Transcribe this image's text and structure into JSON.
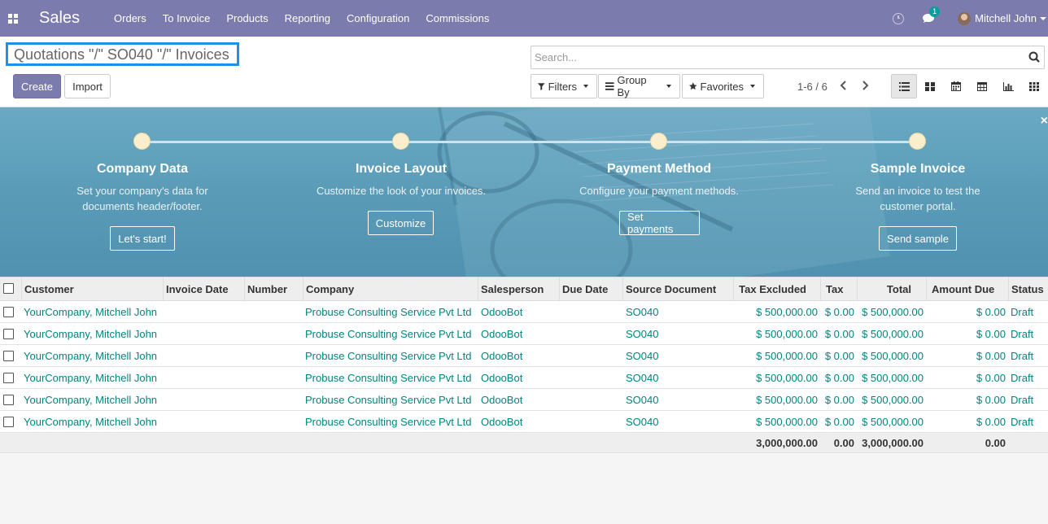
{
  "navbar": {
    "app_name": "Sales",
    "menu": [
      "Orders",
      "To Invoice",
      "Products",
      "Reporting",
      "Configuration",
      "Commissions"
    ],
    "chat_badge": "1",
    "user_name": "Mitchell John",
    "bg_color": "#7c7bad"
  },
  "breadcrumb": "Quotations \"/\" SO040 \"/\" Invoices",
  "buttons": {
    "create": "Create",
    "import": "Import"
  },
  "search": {
    "placeholder": "Search..."
  },
  "filters": {
    "filters": "Filters",
    "group_by": "Group By",
    "favorites": "Favorites"
  },
  "pager": {
    "text": "1-6 / 6"
  },
  "views": [
    "list-view-icon",
    "kanban-view-icon",
    "calendar-view-icon",
    "pivot-view-icon",
    "graph-view-icon",
    "activity-view-icon"
  ],
  "banner": {
    "close": "×",
    "steps": [
      {
        "title": "Company Data",
        "desc1": "Set your company's data for",
        "desc2": "documents header/footer.",
        "button": "Let's start!"
      },
      {
        "title": "Invoice Layout",
        "desc1": "Customize the look of your invoices.",
        "desc2": "",
        "button": "Customize"
      },
      {
        "title": "Payment Method",
        "desc1": "Configure your payment methods.",
        "desc2": "",
        "button": "Set payments"
      },
      {
        "title": "Sample Invoice",
        "desc1": "Send an invoice to test the",
        "desc2": "customer portal.",
        "button": "Send sample"
      }
    ]
  },
  "table": {
    "headers": [
      "Customer",
      "Invoice Date",
      "Number",
      "Company",
      "Salesperson",
      "Due Date",
      "Source Document",
      "Tax Excluded",
      "Tax",
      "Total",
      "Amount Due",
      "Status"
    ],
    "rows": [
      [
        "YourCompany, Mitchell John",
        "",
        "",
        "Probuse Consulting Service Pvt Ltd",
        "OdooBot",
        "",
        "SO040",
        "$ 500,000.00",
        "$ 0.00",
        "$ 500,000.00",
        "$ 0.00",
        "Draft"
      ],
      [
        "YourCompany, Mitchell John",
        "",
        "",
        "Probuse Consulting Service Pvt Ltd",
        "OdooBot",
        "",
        "SO040",
        "$ 500,000.00",
        "$ 0.00",
        "$ 500,000.00",
        "$ 0.00",
        "Draft"
      ],
      [
        "YourCompany, Mitchell John",
        "",
        "",
        "Probuse Consulting Service Pvt Ltd",
        "OdooBot",
        "",
        "SO040",
        "$ 500,000.00",
        "$ 0.00",
        "$ 500,000.00",
        "$ 0.00",
        "Draft"
      ],
      [
        "YourCompany, Mitchell John",
        "",
        "",
        "Probuse Consulting Service Pvt Ltd",
        "OdooBot",
        "",
        "SO040",
        "$ 500,000.00",
        "$ 0.00",
        "$ 500,000.00",
        "$ 0.00",
        "Draft"
      ],
      [
        "YourCompany, Mitchell John",
        "",
        "",
        "Probuse Consulting Service Pvt Ltd",
        "OdooBot",
        "",
        "SO040",
        "$ 500,000.00",
        "$ 0.00",
        "$ 500,000.00",
        "$ 0.00",
        "Draft"
      ],
      [
        "YourCompany, Mitchell John",
        "",
        "",
        "Probuse Consulting Service Pvt Ltd",
        "OdooBot",
        "",
        "SO040",
        "$ 500,000.00",
        "$ 0.00",
        "$ 500,000.00",
        "$ 0.00",
        "Draft"
      ]
    ],
    "totals": {
      "tax_excluded": "3,000,000.00",
      "tax": "0.00",
      "total": "3,000,000.00",
      "amount_due": "0.00"
    }
  }
}
